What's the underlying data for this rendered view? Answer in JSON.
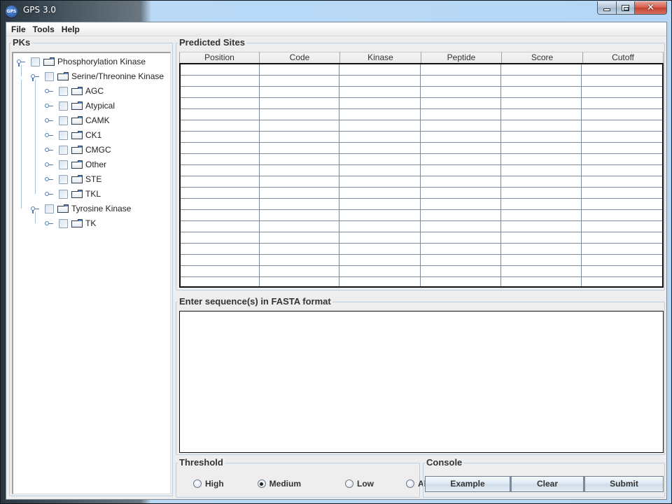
{
  "window": {
    "title": "GPS 3.0",
    "icon_label": "GPS",
    "controls": [
      "minimize",
      "maximize",
      "close"
    ],
    "close_glyph": "✕"
  },
  "menubar": {
    "items": [
      "File",
      "Tools",
      "Help"
    ]
  },
  "pks": {
    "title": "PKs",
    "tree": [
      {
        "label": "Phosphorylation Kinase",
        "level": 0,
        "expanded": true
      },
      {
        "label": "Serine/Threonine Kinase",
        "level": 1,
        "expanded": true
      },
      {
        "label": "AGC",
        "level": 2,
        "expanded": false
      },
      {
        "label": "Atypical",
        "level": 2,
        "expanded": false
      },
      {
        "label": "CAMK",
        "level": 2,
        "expanded": false
      },
      {
        "label": "CK1",
        "level": 2,
        "expanded": false
      },
      {
        "label": "CMGC",
        "level": 2,
        "expanded": false
      },
      {
        "label": "Other",
        "level": 2,
        "expanded": false
      },
      {
        "label": "STE",
        "level": 2,
        "expanded": false
      },
      {
        "label": "TKL",
        "level": 2,
        "expanded": false
      },
      {
        "label": "Tyrosine Kinase",
        "level": 1,
        "expanded": true
      },
      {
        "label": "TK",
        "level": 2,
        "expanded": false
      }
    ]
  },
  "predicted_sites": {
    "title": "Predicted Sites",
    "columns": [
      "Position",
      "Code",
      "Kinase",
      "Peptide",
      "Score",
      "Cutoff"
    ],
    "row_count": 20,
    "rows": []
  },
  "fasta": {
    "title": "Enter sequence(s) in FASTA format",
    "value": ""
  },
  "threshold": {
    "title": "Threshold",
    "options": [
      "High",
      "Medium",
      "Low",
      "All"
    ],
    "selected": "Medium"
  },
  "console": {
    "title": "Console",
    "buttons": [
      "Example",
      "Clear",
      "Submit"
    ]
  }
}
